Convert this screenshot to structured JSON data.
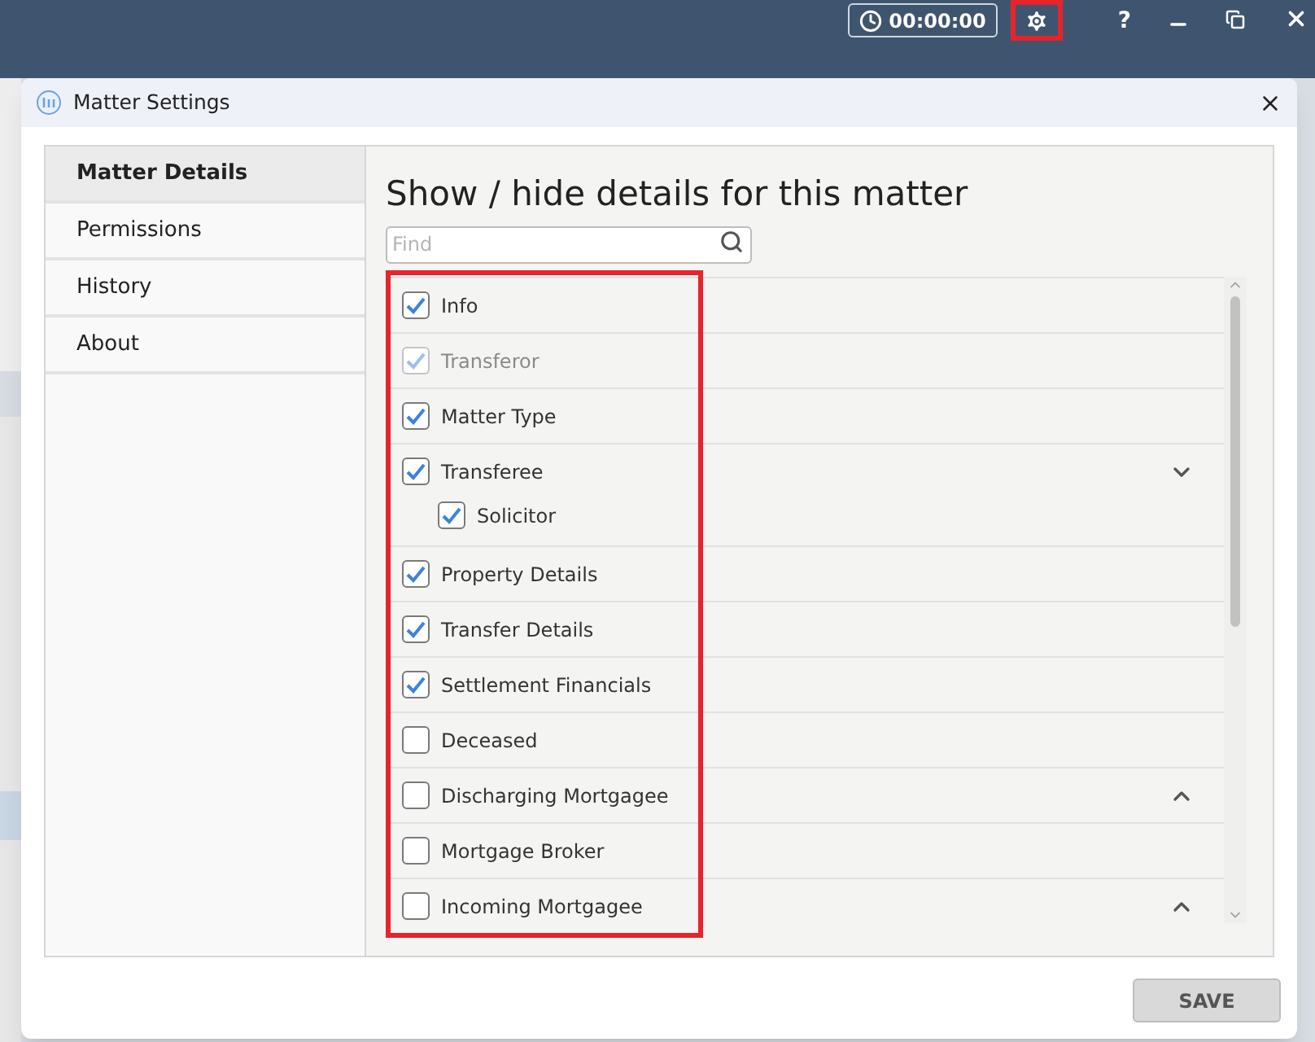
{
  "app_bar": {
    "timer": "00:00:00",
    "help": "?"
  },
  "window": {
    "title": "Matter Settings"
  },
  "sidebar": {
    "items": [
      {
        "label": "Matter Details",
        "selected": true
      },
      {
        "label": "Permissions",
        "selected": false
      },
      {
        "label": "History",
        "selected": false
      },
      {
        "label": "About",
        "selected": false
      }
    ]
  },
  "heading": "Show / hide details for this matter",
  "search": {
    "placeholder": "Find"
  },
  "items": [
    {
      "label": "Info",
      "checked": true,
      "disabled": false
    },
    {
      "label": "Transferor",
      "checked": true,
      "disabled": true
    },
    {
      "label": "Matter Type",
      "checked": true,
      "disabled": false
    },
    {
      "label": "Transferee",
      "checked": true,
      "disabled": false,
      "expanded": true,
      "children": [
        {
          "label": "Solicitor",
          "checked": true,
          "disabled": false
        }
      ]
    },
    {
      "label": "Property Details",
      "checked": true,
      "disabled": false
    },
    {
      "label": "Transfer Details",
      "checked": true,
      "disabled": false
    },
    {
      "label": "Settlement Financials",
      "checked": true,
      "disabled": false
    },
    {
      "label": "Deceased",
      "checked": false,
      "disabled": false
    },
    {
      "label": "Discharging Mortgagee",
      "checked": false,
      "disabled": false,
      "expanded": false
    },
    {
      "label": "Mortgage Broker",
      "checked": false,
      "disabled": false
    },
    {
      "label": "Incoming Mortgagee",
      "checked": false,
      "disabled": false,
      "expanded": false
    }
  ],
  "buttons": {
    "save": "SAVE"
  }
}
